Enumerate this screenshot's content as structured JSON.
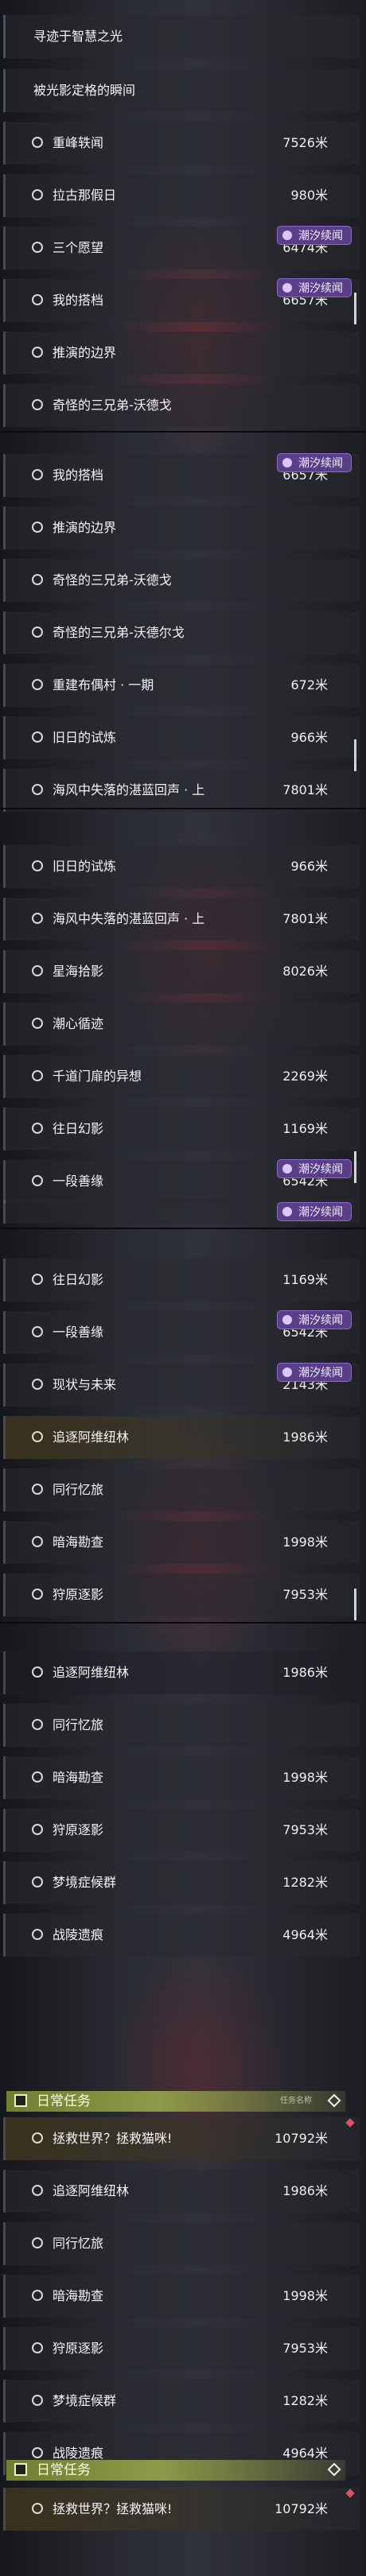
{
  "quests": {
    "a": "寻迹于智慧之光",
    "b": "被光影定格的瞬间",
    "c": "重峰轶闻",
    "d": "拉古那假日",
    "e": "三个愿望",
    "f": "我的搭档",
    "g": "推演的边界",
    "h": "奇怪的三兄弟-沃德戈",
    "i": "奇怪的三兄弟-沃德尔戈",
    "j": "重建布偶村 · 一期",
    "k": "旧日的试炼",
    "l": "海风中失落的湛蓝回声 · 上",
    "m": "星海拾影",
    "n": "潮心循迹",
    "o": "千道门扉的异想",
    "p": "往日幻影",
    "q": "一段善缘",
    "r": "现状与未来",
    "s": "追逐阿维纽林",
    "t": "同行忆旅",
    "u": "暗海勘查",
    "v": "狩原逐影",
    "w": "梦境症候群",
    "x": "战陵遗痕",
    "y": "拯救世界？拯救猫咪!"
  },
  "dist": {
    "c": "7526米",
    "d": "980米",
    "e": "6474米",
    "f": "6657米",
    "j": "672米",
    "k": "966米",
    "l": "7801米",
    "m": "8026米",
    "o": "2269米",
    "p": "1169米",
    "q": "6542米",
    "r": "2143米",
    "s": "1986米",
    "u": "1998米",
    "v": "7953米",
    "w": "1282米",
    "x": "4964米",
    "y": "10792米"
  },
  "badge": "潮汐续闻",
  "daily": {
    "label": "日常任务",
    "small": "任务名称"
  },
  "colors": {
    "badge_bg": "#5a3f86",
    "daily_bg": "#8d9a48",
    "alert": "#e0506a"
  }
}
